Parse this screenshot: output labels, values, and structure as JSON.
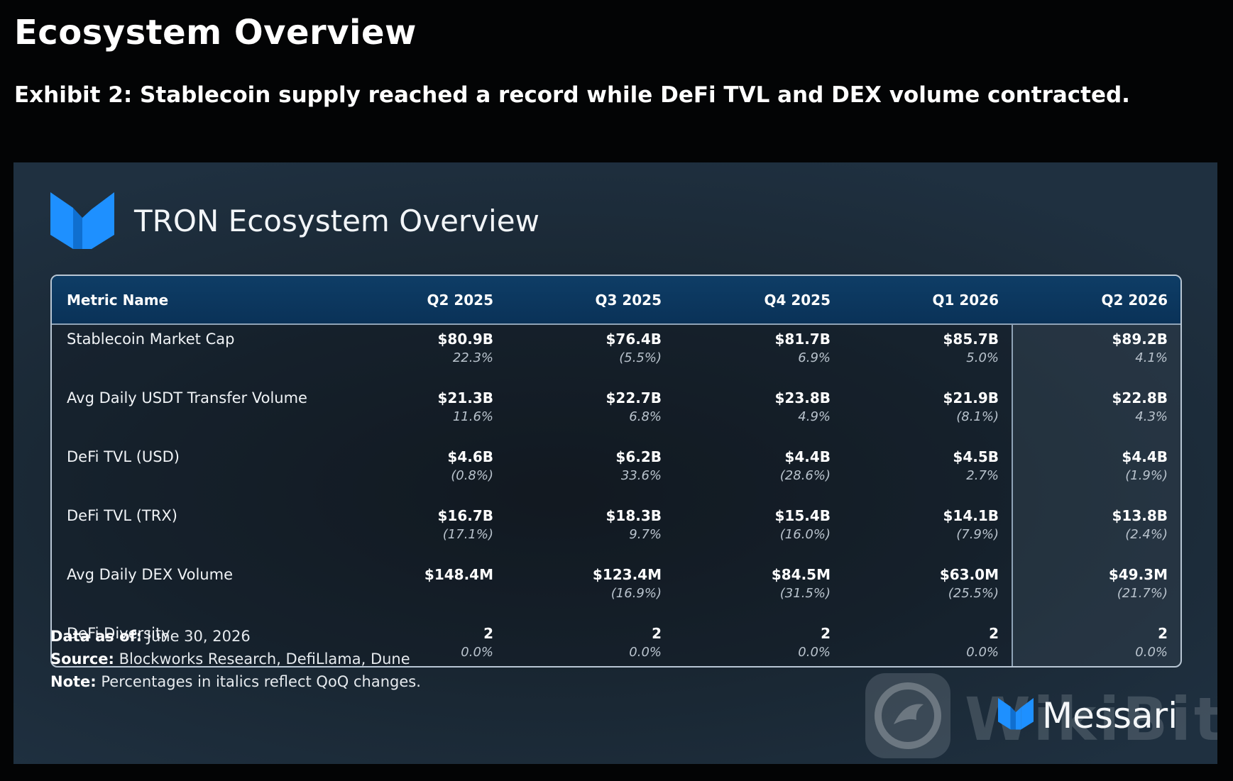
{
  "page": {
    "title": "Ecosystem Overview",
    "subtitle": "Exhibit 2: Stablecoin supply reached a record while DeFi TVL and DEX volume contracted."
  },
  "panel": {
    "title": "TRON Ecosystem Overview",
    "brand_name": "Messari",
    "brand_color": "#1e90ff",
    "watermark_text": "WikiBit"
  },
  "chart_data": {
    "type": "table",
    "title": "TRON Ecosystem Overview",
    "columns": [
      "Metric Name",
      "Q2 2025",
      "Q3 2025",
      "Q4 2025",
      "Q1 2026",
      "Q2 2026"
    ],
    "highlighted_column": "Q2 2026",
    "rows": [
      {
        "metric": "Stablecoin Market Cap",
        "values": [
          "$80.9B",
          "$76.4B",
          "$81.7B",
          "$85.7B",
          "$89.2B"
        ],
        "changes": [
          "22.3%",
          "(5.5%)",
          "6.9%",
          "5.0%",
          "4.1%"
        ]
      },
      {
        "metric": "Avg Daily USDT Transfer Volume",
        "values": [
          "$21.3B",
          "$22.7B",
          "$23.8B",
          "$21.9B",
          "$22.8B"
        ],
        "changes": [
          "11.6%",
          "6.8%",
          "4.9%",
          "(8.1%)",
          "4.3%"
        ]
      },
      {
        "metric": "DeFi TVL (USD)",
        "values": [
          "$4.6B",
          "$6.2B",
          "$4.4B",
          "$4.5B",
          "$4.4B"
        ],
        "changes": [
          "(0.8%)",
          "33.6%",
          "(28.6%)",
          "2.7%",
          "(1.9%)"
        ]
      },
      {
        "metric": "DeFi TVL (TRX)",
        "values": [
          "$16.7B",
          "$18.3B",
          "$15.4B",
          "$14.1B",
          "$13.8B"
        ],
        "changes": [
          "(17.1%)",
          "9.7%",
          "(16.0%)",
          "(7.9%)",
          "(2.4%)"
        ]
      },
      {
        "metric": "Avg Daily DEX Volume",
        "values": [
          "$148.4M",
          "$123.4M",
          "$84.5M",
          "$63.0M",
          "$49.3M"
        ],
        "changes": [
          "",
          "(16.9%)",
          "(31.5%)",
          "(25.5%)",
          "(21.7%)"
        ]
      },
      {
        "metric": "DeFi Diversity",
        "values": [
          "2",
          "2",
          "2",
          "2",
          "2"
        ],
        "changes": [
          "0.0%",
          "0.0%",
          "0.0%",
          "0.0%",
          "0.0%"
        ]
      }
    ]
  },
  "footer": {
    "data_as_of_label": "Data as of:",
    "data_as_of_value": "June 30, 2026",
    "source_label": "Source:",
    "source_value": "Blockworks Research, DefiLlama, Dune",
    "note_label": "Note:",
    "note_value": "Percentages in italics reflect QoQ changes."
  }
}
